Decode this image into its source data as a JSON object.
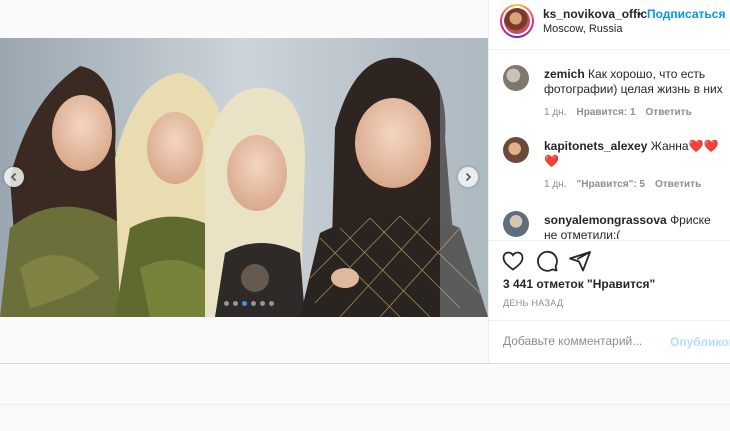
{
  "post": {
    "username": "ks_novikova_offic",
    "bullet": "•",
    "follow_label": "Подписаться",
    "location": "Moscow, Russia",
    "carousel": {
      "active_index": 2,
      "count": 6
    }
  },
  "comments": [
    {
      "username": "zemich",
      "text": "Как хорошо, что есть фотографии) целая жизнь в них",
      "time": "1 дн.",
      "likes": "Нравится: 1",
      "reply": "Ответить"
    },
    {
      "username": "kapitonets_alexey",
      "text": "Жанна❤️❤️❤️",
      "time": "1 дн.",
      "likes": "\"Нравится\": 5",
      "reply": "Ответить"
    },
    {
      "username": "sonyalemongrassova",
      "text": "Фриске не отметили:(",
      "time": "",
      "likes": "",
      "reply": ""
    }
  ],
  "likes_text": "3 441 отметок \"Нравится\"",
  "date_text": "ДЕНЬ НАЗАД",
  "add_comment": {
    "placeholder": "Добавьте комментарий...",
    "post_label": "Опубликовать"
  },
  "colors": {
    "link": "#0095f6",
    "heart": "#ed4956",
    "disabled_post": "#b2dffc"
  }
}
